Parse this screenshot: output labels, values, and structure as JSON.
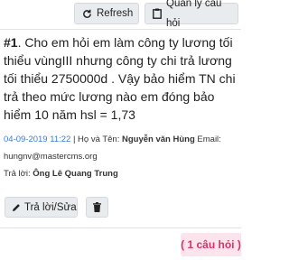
{
  "toolbar": {
    "refresh_label": "Refresh",
    "manage_label": "Quản lý câu hỏi"
  },
  "question": {
    "number": "#1",
    "text": ". Cho em hỏi em làm công ty lương tối thiểu vùngIII nhưng công ty chi trả lương tối thiểu 2750000d . Vậy bảo hiểm TN chi trả theo mức lương nào em đóng bảo hiểm 10 năm hsl = 1,73",
    "date": "04-09-2019 11:22",
    "name_label": " | Họ và Tên: ",
    "asker_name": "Nguyễn văn Hùng",
    "email_label": " Email:",
    "email": "hungnv@mastercms.org",
    "answer_label": "Trả lời: ",
    "answerer": "Ông Lê Quang Trung"
  },
  "actions": {
    "reply_label": "Trả lời/Sửa"
  },
  "footer": {
    "count_text": "( 1 câu hỏi )"
  },
  "colors": {
    "date": "#3a7bd5",
    "badge_text": "#d6336c",
    "badge_bg": "#fbe4ec"
  }
}
